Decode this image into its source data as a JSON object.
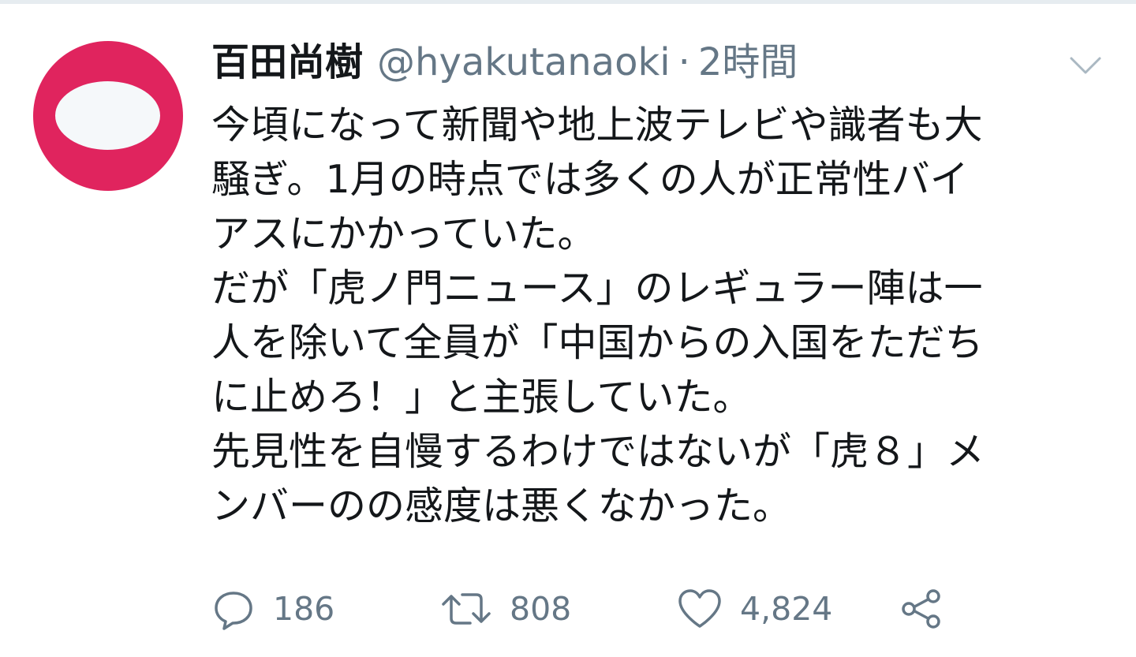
{
  "tweet": {
    "author": {
      "display_name": "百田尚樹",
      "handle": "@hyakutanaoki",
      "separator": "·",
      "time": "2時間",
      "avatar_color": "#e0245e"
    },
    "text_lines": [
      "今頃になって新聞や地上波テレビや識者も大",
      "騒ぎ。1月の時点では多くの人が正常性バイ",
      "アスにかかっていた。",
      "だが「虎ノ門ニュース」のレギュラー陣は一",
      "人を除いて全員が「中国からの入国をただち",
      "に止めろ！」と主張していた。",
      "先見性を自慢するわけではないが「虎８」メ",
      "ンバーのの感度は悪くなかった。"
    ],
    "menu_icon": "chevron-down-icon",
    "actions": {
      "reply": {
        "icon": "reply-icon",
        "count": "186"
      },
      "retweet": {
        "icon": "retweet-icon",
        "count": "808"
      },
      "like": {
        "icon": "heart-icon",
        "count": "4,824"
      },
      "share": {
        "icon": "share-icon"
      }
    }
  },
  "colors": {
    "text_primary": "#14171a",
    "text_secondary": "#657786",
    "divider": "#e6ecf0"
  }
}
